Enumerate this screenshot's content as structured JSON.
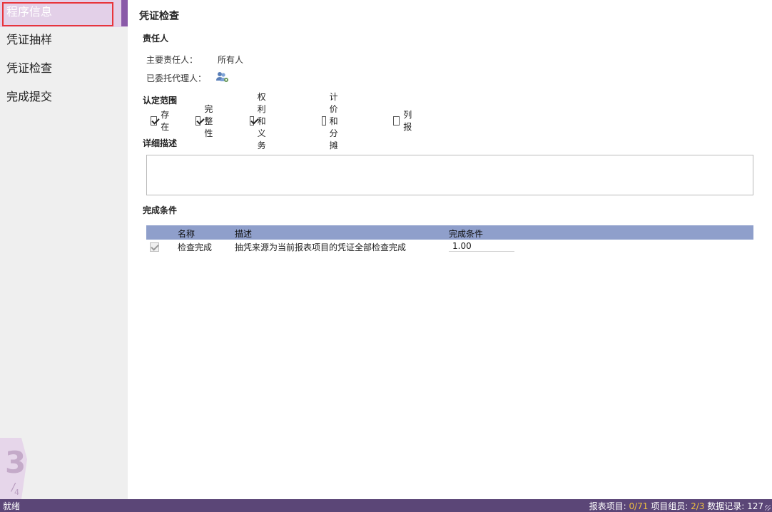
{
  "sidebar": {
    "items": [
      {
        "label": "程序信息",
        "active": true
      },
      {
        "label": "凭证抽样",
        "active": false
      },
      {
        "label": "凭证检查",
        "active": false
      },
      {
        "label": "完成提交",
        "active": false
      }
    ],
    "step": {
      "current": "3",
      "separator": "/",
      "total": "4"
    }
  },
  "main": {
    "title": "凭证检查",
    "responsible": {
      "section_title": "责任人",
      "primary_label": "主要责任人：",
      "primary_value": "所有人",
      "delegate_label": "已委托代理人：",
      "delegate_icon": "users-gear-icon"
    },
    "scope": {
      "section_title": "认定范围",
      "options": [
        {
          "label": "存在",
          "checked": true
        },
        {
          "label": "完整性",
          "checked": true
        },
        {
          "label": "权利和义务",
          "checked": true
        },
        {
          "label": "计价和分摊",
          "checked": false
        },
        {
          "label": "列报",
          "checked": false
        }
      ]
    },
    "description": {
      "section_title": "详细描述",
      "value": ""
    },
    "completion": {
      "section_title": "完成条件",
      "columns": [
        "名称",
        "描述",
        "完成条件"
      ],
      "rows": [
        {
          "checked": true,
          "name": "检查完成",
          "desc": "抽凭来源为当前报表项目的凭证全部检查完成",
          "condition": "1.00"
        }
      ]
    }
  },
  "status": {
    "text": "就绪",
    "report_items_label": "报表项目: ",
    "report_items_value": "0/71",
    "groups_label": " 项目组员: ",
    "groups_value": "2/3",
    "records_label": " 数据记录: ",
    "records_value": "127"
  },
  "colors": {
    "accent": "#8a5aa8",
    "active_bg": "#e3d0e8",
    "grid_header": "#8f9fcb",
    "statusbar": "#5b4677",
    "highlight": "#f0c040"
  }
}
